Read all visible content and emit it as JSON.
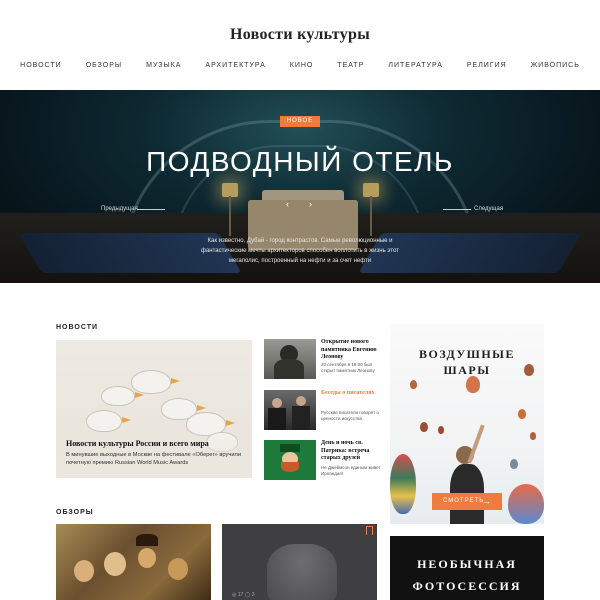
{
  "header": {
    "title": "Новости культуры",
    "nav": [
      "НОВОСТИ",
      "ОБЗОРЫ",
      "МУЗЫКА",
      "АРХИТЕКТУРА",
      "КИНО",
      "ТЕАТР",
      "ЛИТЕРАТУРА",
      "РЕЛИГИЯ",
      "ЖИВОПИСЬ"
    ]
  },
  "hero": {
    "badge": "НОВОЕ",
    "title": "ПОДВОДНЫЙ ОТЕЛЬ",
    "prev": "Предыдущая",
    "next": "Следущая",
    "description": "Как известно, Дубай - город контрастов. Самые революционные и фантастические мечты архитекторов способен воплотить в жизнь этот мегаполис, построенный на нефти и за счет нефти"
  },
  "news_section": {
    "title": "НОВОСТИ",
    "featured": {
      "title": "Новости культуры России и всего мира",
      "subtitle": "В минувшие выходные в Москве на фестивале «Оберег» вручили почетную премию Russian World Music Awards"
    },
    "items": [
      {
        "title": "Открытие нового памятника Евгению Леонову",
        "text": "20 сентября в 19:00 был открыт памятник Леонову"
      },
      {
        "title": "Беседы о писателях",
        "text": "Русские писатели говорят о ценности искусства"
      },
      {
        "title": "День и ночь св. Патрика: встреча старых друзей",
        "text": "Не Джеймсон единым живет Ирландия!"
      }
    ]
  },
  "promo": {
    "title_line1": "ВОЗДУШНЫЕ",
    "title_line2": "ШАРЫ",
    "button": "СМОТРЕТЬ",
    "button_arrow": "→"
  },
  "reviews_section": {
    "title": "ОБЗОРЫ",
    "meta": "◎ 17   ◯ 3"
  },
  "promo2": {
    "title_line1": "НЕОБЫЧНАЯ",
    "title_line2": "ФОТОСЕССИЯ"
  },
  "colors": {
    "accent": "#f07b3f",
    "text": "#222222"
  }
}
